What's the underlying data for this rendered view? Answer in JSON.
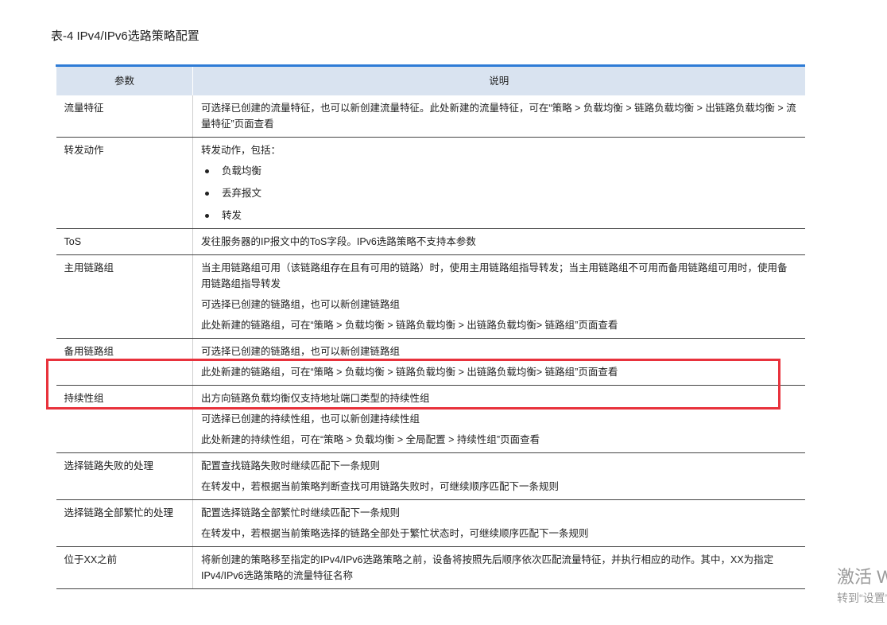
{
  "caption": "表-4 IPv4/IPv6选路策略配置",
  "table": {
    "headers": [
      "参数",
      "说明"
    ],
    "rows": [
      {
        "param": "流量特征",
        "paras": [
          "可选择已创建的流量特征，也可以新创建流量特征。此处新建的流量特征，可在“策略 > 负载均衡 > 链路负载均衡 > 出链路负载均衡 > 流量特征”页面查看"
        ]
      },
      {
        "param": "转发动作",
        "paras": [
          "转发动作，包括："
        ],
        "bullets": [
          "负载均衡",
          "丢弃报文",
          "转发"
        ]
      },
      {
        "param": "ToS",
        "paras": [
          "发往服务器的IP报文中的ToS字段。IPv6选路策略不支持本参数"
        ]
      },
      {
        "param": "主用链路组",
        "paras": [
          "当主用链路组可用（该链路组存在且有可用的链路）时，使用主用链路组指导转发；当主用链路组不可用而备用链路组可用时，使用备用链路组指导转发",
          "可选择已创建的链路组，也可以新创建链路组",
          "此处新建的链路组，可在“策略 > 负载均衡 > 链路负载均衡 > 出链路负载均衡> 链路组”页面查看"
        ]
      },
      {
        "param": "备用链路组",
        "paras": [
          "可选择已创建的链路组，也可以新创建链路组",
          "此处新建的链路组，可在“策略 > 负载均衡 > 链路负载均衡 > 出链路负载均衡> 链路组”页面查看"
        ]
      },
      {
        "param": "持续性组",
        "paras": [
          "出方向链路负载均衡仅支持地址端口类型的持续性组",
          "可选择已创建的持续性组，也可以新创建持续性组",
          "此处新建的持续性组，可在“策略 > 负载均衡 > 全局配置 > 持续性组”页面查看"
        ]
      },
      {
        "param": "选择链路失败的处理",
        "paras": [
          "配置查找链路失败时继续匹配下一条规则",
          "在转发中，若根据当前策略判断查找可用链路失败时，可继续顺序匹配下一条规则"
        ]
      },
      {
        "param": "选择链路全部繁忙的处理",
        "paras": [
          "配置选择链路全部繁忙时继续匹配下一条规则",
          "在转发中，若根据当前策略选择的链路全部处于繁忙状态时，可继续顺序匹配下一条规则"
        ]
      },
      {
        "param": "位于XX之前",
        "paras": [
          "将新创建的策略移至指定的IPv4/IPv6选路策略之前，设备将按照先后顺序依次匹配流量特征，并执行相应的动作。其中，XX为指定IPv4/IPv6选路策略的流量特征名称"
        ]
      }
    ]
  },
  "watermark": {
    "line1": "激活 W",
    "line2": "转到“设置”"
  },
  "colors": {
    "header_bg": "#d9e3f0",
    "header_top_border": "#2e7bd6",
    "highlight": "#e8323c"
  }
}
